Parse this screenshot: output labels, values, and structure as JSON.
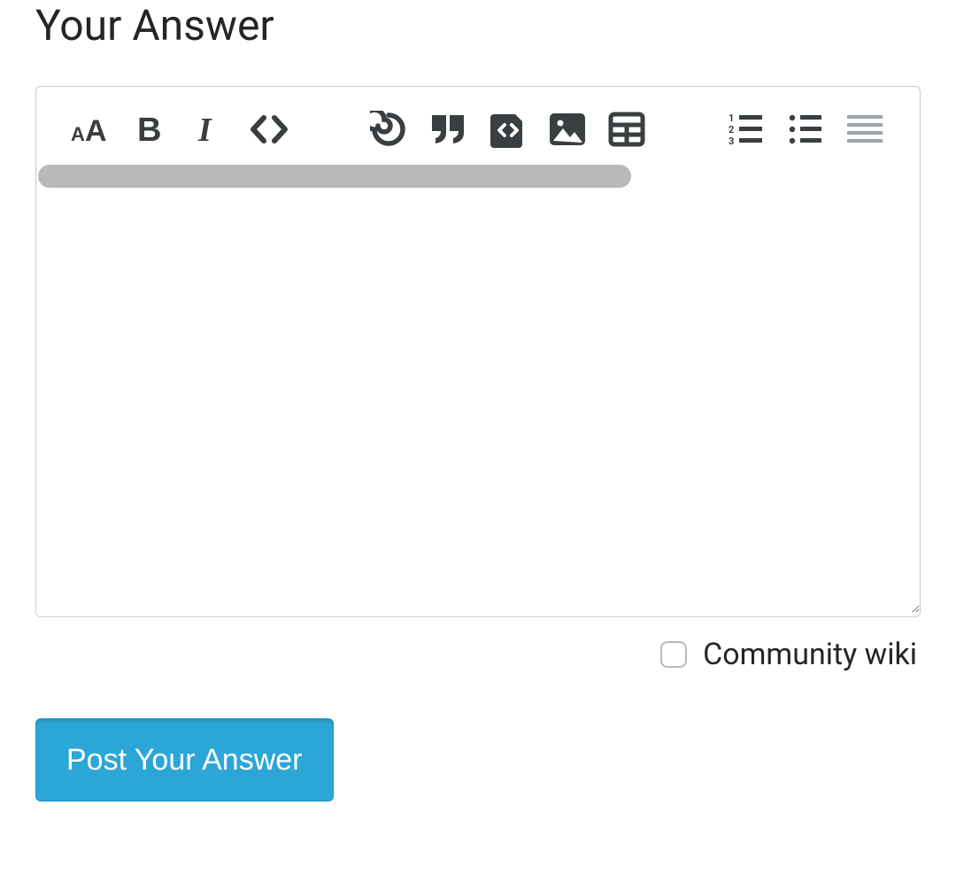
{
  "heading": "Your Answer",
  "toolbar": {
    "heading_name": "heading-icon",
    "bold_name": "bold-icon",
    "italic_name": "italic-icon",
    "inline_code_name": "inline-code-icon",
    "link_name": "link-icon",
    "quote_name": "quote-icon",
    "code_block_name": "code-block-icon",
    "image_name": "image-icon",
    "table_name": "table-icon",
    "ordered_list_name": "ordered-list-icon",
    "unordered_list_name": "unordered-list-icon",
    "horizontal_rule_name": "horizontal-rule-icon"
  },
  "editor": {
    "value": ""
  },
  "community_wiki": {
    "label": "Community wiki",
    "checked": false
  },
  "submit": {
    "label": "Post Your Answer"
  }
}
